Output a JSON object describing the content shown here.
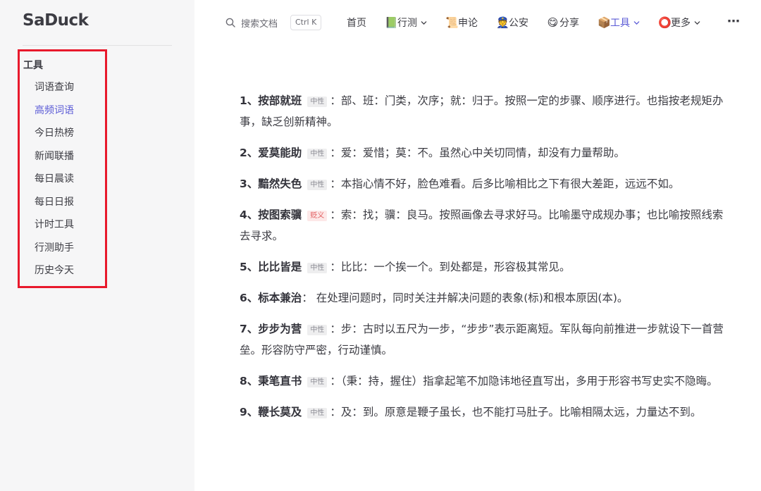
{
  "brand": {
    "logo": "SaDuck"
  },
  "sidebar": {
    "group_title": "工具",
    "items": [
      {
        "label": "词语查询",
        "active": false
      },
      {
        "label": "高频词语",
        "active": true
      },
      {
        "label": "今日热榜",
        "active": false
      },
      {
        "label": "新闻联播",
        "active": false
      },
      {
        "label": "每日晨读",
        "active": false
      },
      {
        "label": "每日日报",
        "active": false
      },
      {
        "label": "计时工具",
        "active": false
      },
      {
        "label": "行测助手",
        "active": false
      },
      {
        "label": "历史今天",
        "active": false
      }
    ]
  },
  "topnav": {
    "search_placeholder": "搜索文档",
    "shortcut": "Ctrl K",
    "items": [
      {
        "label": "首页",
        "icon": "",
        "dropdown": false
      },
      {
        "label": "行测",
        "icon": "📗",
        "dropdown": true
      },
      {
        "label": "申论",
        "icon": "📜",
        "dropdown": false
      },
      {
        "label": "公安",
        "icon": "👮",
        "dropdown": false
      },
      {
        "label": "分享",
        "icon": "😋",
        "dropdown": false
      },
      {
        "label": "工具",
        "icon": "📦",
        "dropdown": true,
        "active": true
      },
      {
        "label": "更多",
        "icon": "⭕",
        "dropdown": true
      }
    ],
    "more_icon": "⋯"
  },
  "entries": [
    {
      "index": "1、",
      "word": "按部就班",
      "tag": "中性",
      "tag_type": "neutral",
      "definition": "：部、班：门类，次序；就：归于。按照一定的步骤、顺序进行。也指按老规矩办事，缺乏创新精神。"
    },
    {
      "index": "2、",
      "word": "爱莫能助",
      "tag": "中性",
      "tag_type": "neutral",
      "definition": "：爱：爱惜；莫：不。虽然心中关切同情，却没有力量帮助。"
    },
    {
      "index": "3、",
      "word": "黯然失色",
      "tag": "中性",
      "tag_type": "neutral",
      "definition": "：本指心情不好，脸色难看。后多比喻相比之下有很大差距，远远不如。"
    },
    {
      "index": "4、",
      "word": "按图索骥",
      "tag": "贬义",
      "tag_type": "negative",
      "definition": "：索：找；骥：良马。按照画像去寻求好马。比喻墨守成规办事；也比喻按照线索去寻求。"
    },
    {
      "index": "5、",
      "word": "比比皆是",
      "tag": "中性",
      "tag_type": "neutral",
      "definition": "：比比：一个挨一个。到处都是，形容极其常见。"
    },
    {
      "index": "6、",
      "word": "标本兼治",
      "tag": "",
      "tag_type": "",
      "definition": "： 在处理问题时，同时关注并解决问题的表象(标)和根本原因(本)。"
    },
    {
      "index": "7、",
      "word": "步步为营",
      "tag": "中性",
      "tag_type": "neutral",
      "definition": "：步：古时以五尺为一步，“步步”表示距离短。军队每向前推进一步就设下一首营垒。形容防守严密，行动谨慎。"
    },
    {
      "index": "8、",
      "word": "秉笔直书",
      "tag": "中性",
      "tag_type": "neutral",
      "definition": "：（秉：持，握住）指拿起笔不加隐讳地径直写出，多用于形容书写史实不隐晦。"
    },
    {
      "index": "9、",
      "word": "鞭长莫及",
      "tag": "中性",
      "tag_type": "neutral",
      "definition": "：及：到。原意是鞭子虽长，也不能打马肚子。比喻相隔太远，力量达不到。"
    }
  ],
  "colors": {
    "accent": "#5b5bd6",
    "highlight_border": "#e8192c",
    "sidebar_bg": "#f6f6f7"
  }
}
